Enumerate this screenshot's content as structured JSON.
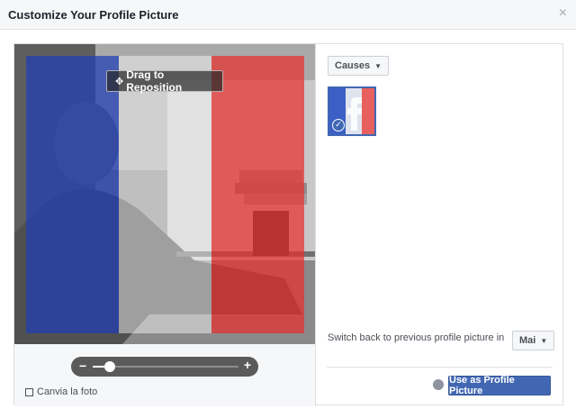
{
  "dialog": {
    "title": "Customize Your Profile Picture",
    "close_glyph": "×"
  },
  "photo": {
    "drag_label": "Drag to Reposition",
    "drag_icon": "move-icon",
    "overlay_colors": [
      "#1f3fb5",
      "#ffffff",
      "#e8312f"
    ]
  },
  "zoom": {
    "minus": "−",
    "plus": "+",
    "level": 0.12
  },
  "change_photo": {
    "label": "Canvia la foto",
    "icon": "photo-icon"
  },
  "frames": {
    "category_label": "Causes",
    "selected_frame_icon": "checkmark-icon"
  },
  "switch_back": {
    "label": "Switch back to previous profile picture in",
    "value": "Mai"
  },
  "actions": {
    "privacy_icon": "globe-icon",
    "primary_label": "Use as Profile Picture"
  },
  "colors": {
    "accent": "#4267b2",
    "title_bar": "#f6f7f9"
  }
}
